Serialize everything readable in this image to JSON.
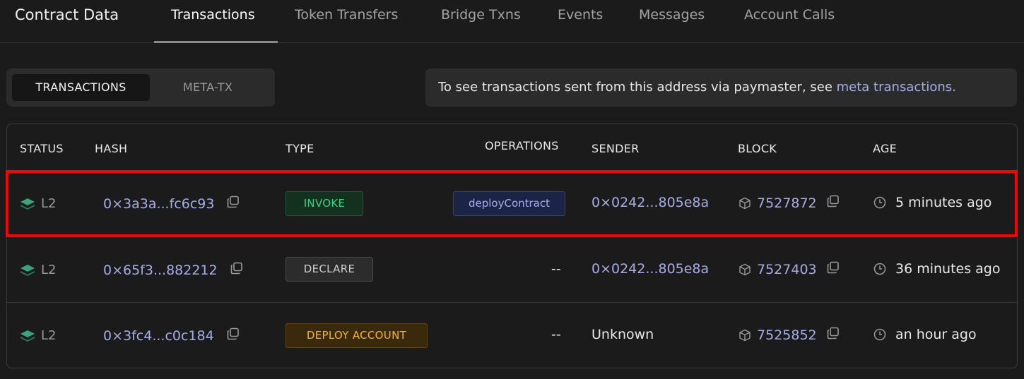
{
  "header": {
    "title": "Contract Data",
    "tabs": [
      "Transactions",
      "Token Transfers",
      "Bridge Txns",
      "Events",
      "Messages",
      "Account Calls"
    ],
    "active_tab": "Transactions"
  },
  "segmented": {
    "options": [
      "TRANSACTIONS",
      "META-TX"
    ],
    "active": "TRANSACTIONS"
  },
  "info": {
    "text": "To see transactions sent from this address via paymaster, see ",
    "link": "meta transactions."
  },
  "table": {
    "columns": [
      "STATUS",
      "HASH",
      "TYPE",
      "OPERATIONS",
      "SENDER",
      "BLOCK",
      "AGE"
    ],
    "rows": [
      {
        "status": "L2",
        "hash": "0×3a3a...fc6c93",
        "type": "INVOKE",
        "type_style": "invoke",
        "operations": "deployContract",
        "sender": "0×0242...805e8a",
        "block": "7527872",
        "age": "5 minutes ago"
      },
      {
        "status": "L2",
        "hash": "0×65f3...882212",
        "type": "DECLARE",
        "type_style": "declare",
        "operations": "--",
        "sender": "0×0242...805e8a",
        "block": "7527403",
        "age": "36 minutes ago"
      },
      {
        "status": "L2",
        "hash": "0×3fc4...c0c184",
        "type": "DEPLOY ACCOUNT",
        "type_style": "deploy",
        "operations": "--",
        "sender": "Unknown",
        "block": "7525852",
        "age": "an hour ago"
      }
    ]
  },
  "colors": {
    "link": "#a4aee6",
    "highlight": "#ff0000",
    "invoke": "#3ed08a",
    "deploy": "#f5b52c",
    "status_icon": "#3aa57a"
  },
  "icons": [
    "layers-icon",
    "copy-icon",
    "cube-icon",
    "clock-icon"
  ]
}
